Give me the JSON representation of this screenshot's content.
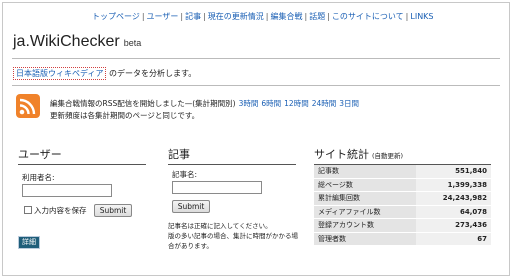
{
  "nav": {
    "items": [
      "トップページ",
      "ユーザー",
      "記事",
      "現在の更新情況",
      "編集合戦",
      "話題",
      "このサイトについて",
      "LINKS"
    ],
    "separator": "|"
  },
  "site": {
    "title": "ja.WikiChecker",
    "badge": "beta"
  },
  "intro": {
    "link_text": "日本語版ウィキペディア",
    "suffix": " のデータを分析します。"
  },
  "rss": {
    "line1": "編集合戦情報のRSS配信を開始しました—(集計期間別)",
    "periods": [
      "3時間",
      "6時間",
      "12時間",
      "24時間",
      "3日間"
    ],
    "line2": "更新頻度は各集計期間のページと同じです。"
  },
  "user_panel": {
    "heading": "ユーザー",
    "username_label": "利用者名:",
    "username_value": "",
    "save_label": "入力内容を保存",
    "save_checked": false,
    "submit_label": "Submit",
    "detail_label": "詳細"
  },
  "article_panel": {
    "heading": "記事",
    "article_label": "記事名:",
    "article_value": "",
    "submit_label": "Submit",
    "notes": [
      "記事名は正確に記入してください。",
      "版の多い記事の場合、集計に時間がかかる場",
      "合があります。"
    ]
  },
  "stats_panel": {
    "heading": "サイト統計",
    "heading_note": "(自動更新)",
    "rows": [
      {
        "label": "記事数",
        "value": "551,840"
      },
      {
        "label": "総ページ数",
        "value": "1,399,338"
      },
      {
        "label": "累計編集回数",
        "value": "24,243,982"
      },
      {
        "label": "メディアファイル数",
        "value": "64,078"
      },
      {
        "label": "登録アカウント数",
        "value": "273,436"
      },
      {
        "label": "管理者数",
        "value": "67"
      }
    ]
  },
  "colors": {
    "link": "#1a5fb4",
    "rss": "#f0822a",
    "detail_button": "#1f5e7a"
  },
  "icons": {
    "rss": "rss-feed-icon"
  }
}
